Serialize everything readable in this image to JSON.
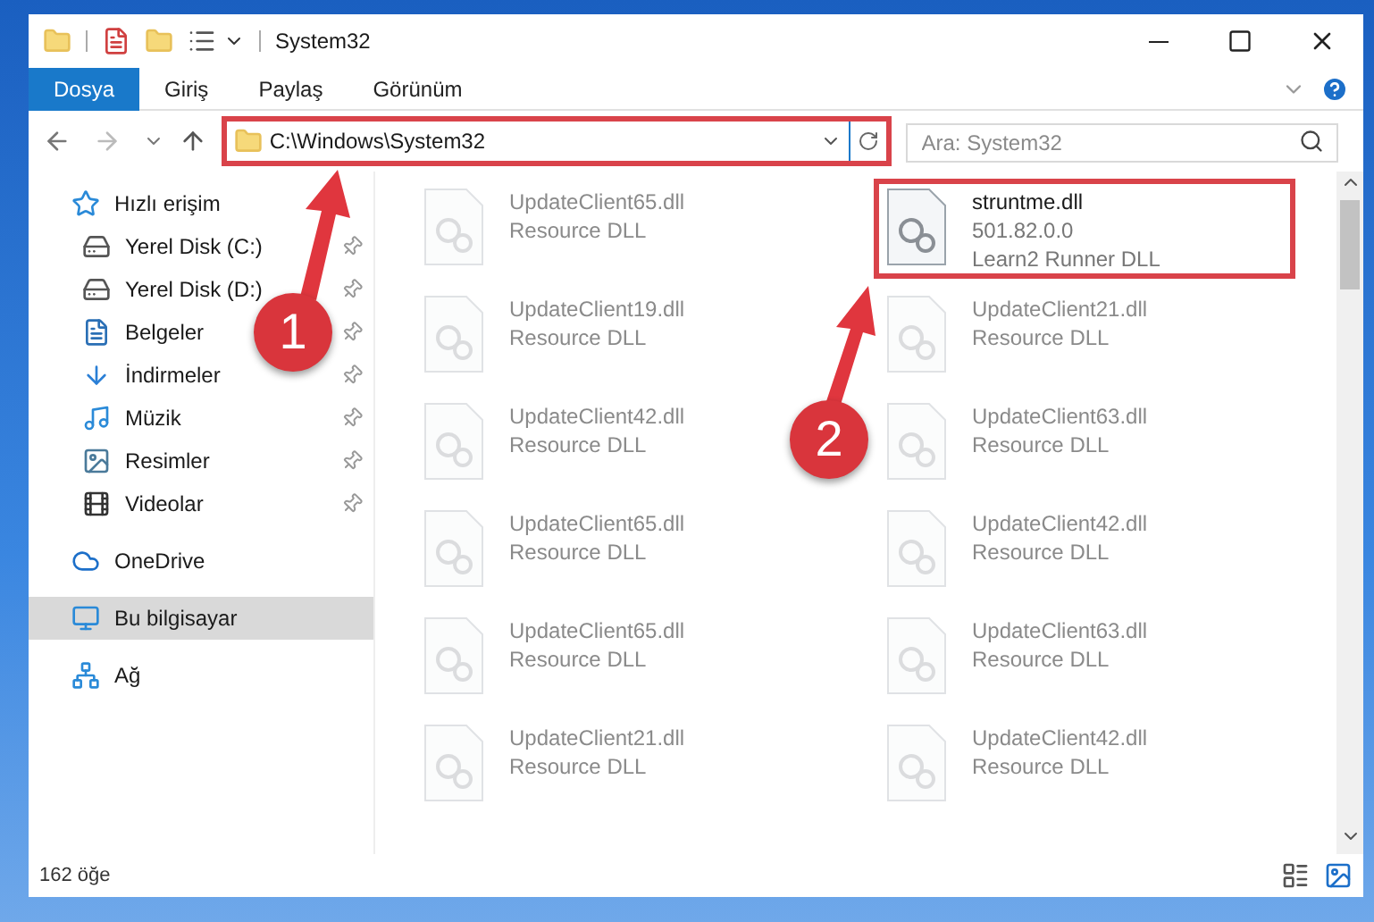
{
  "window": {
    "title": "System32"
  },
  "ribbon_tabs": [
    {
      "label": "Dosya",
      "selected": true
    },
    {
      "label": "Giriş",
      "selected": false
    },
    {
      "label": "Paylaş",
      "selected": false
    },
    {
      "label": "Görünüm",
      "selected": false
    }
  ],
  "address": {
    "path": "C:\\Windows\\System32",
    "highlighted": true
  },
  "search": {
    "placeholder": "Ara: System32"
  },
  "nav": [
    {
      "label": "Hızlı erişim",
      "kind": "star",
      "selected": false,
      "children": [
        {
          "label": "Yerel Disk (C:)",
          "kind": "drive",
          "pinned": true,
          "selected": false
        },
        {
          "label": "Yerel Disk (D:)",
          "kind": "drive",
          "pinned": true,
          "selected": false
        },
        {
          "label": "Belgeler",
          "kind": "document",
          "pinned": true,
          "selected": false
        },
        {
          "label": "İndirmeler",
          "kind": "download",
          "pinned": true,
          "selected": false
        },
        {
          "label": "Müzik",
          "kind": "music",
          "pinned": true,
          "selected": false
        },
        {
          "label": "Resimler",
          "kind": "image",
          "pinned": true,
          "selected": false
        },
        {
          "label": "Videolar",
          "kind": "video",
          "pinned": true,
          "selected": false
        }
      ]
    },
    {
      "label": "OneDrive",
      "kind": "cloud",
      "selected": false
    },
    {
      "label": "Bu bilgisayar",
      "kind": "computer",
      "selected": true
    },
    {
      "label": "Ağ",
      "kind": "network",
      "selected": false
    }
  ],
  "files": [
    {
      "name": "UpdateClient65.dll",
      "details": [
        "Resource DLL"
      ],
      "faded": true,
      "highlighted": false
    },
    {
      "name": "struntme.dll",
      "details": [
        "501.82.0.0",
        "Learn2 Runner DLL"
      ],
      "faded": false,
      "highlighted": true
    },
    {
      "name": "UpdateClient19.dll",
      "details": [
        "Resource DLL"
      ],
      "faded": true,
      "highlighted": false
    },
    {
      "name": "UpdateClient21.dll",
      "details": [
        "Resource DLL"
      ],
      "faded": true,
      "highlighted": false
    },
    {
      "name": "UpdateClient42.dll",
      "details": [
        "Resource DLL"
      ],
      "faded": true,
      "highlighted": false
    },
    {
      "name": "UpdateClient63.dll",
      "details": [
        "Resource DLL"
      ],
      "faded": true,
      "highlighted": false
    },
    {
      "name": "UpdateClient65.dll",
      "details": [
        "Resource DLL"
      ],
      "faded": true,
      "highlighted": false
    },
    {
      "name": "UpdateClient42.dll",
      "details": [
        "Resource DLL"
      ],
      "faded": true,
      "highlighted": false
    },
    {
      "name": "UpdateClient65.dll",
      "details": [
        "Resource DLL"
      ],
      "faded": true,
      "highlighted": false
    },
    {
      "name": "UpdateClient63.dll",
      "details": [
        "Resource DLL"
      ],
      "faded": true,
      "highlighted": false
    },
    {
      "name": "UpdateClient21.dll",
      "details": [
        "Resource DLL"
      ],
      "faded": true,
      "highlighted": false
    },
    {
      "name": "UpdateClient42.dll",
      "details": [
        "Resource DLL"
      ],
      "faded": true,
      "highlighted": false
    }
  ],
  "status_bar": {
    "count": "162 öğe"
  },
  "callouts": [
    {
      "number": "1"
    },
    {
      "number": "2"
    }
  ]
}
